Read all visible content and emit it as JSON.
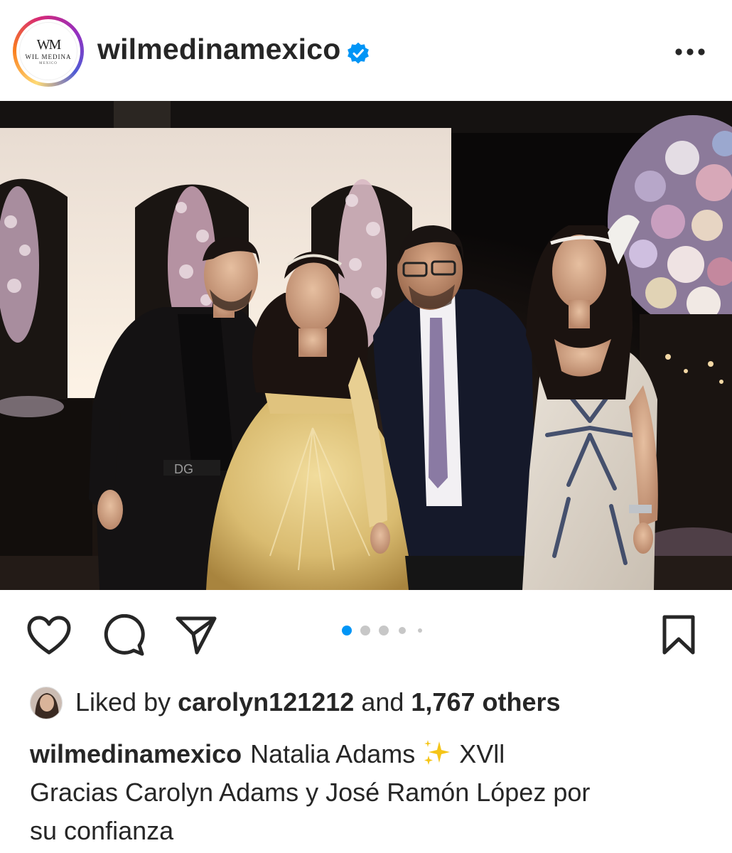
{
  "header": {
    "username": "wilmedinamexico",
    "verified": true,
    "avatar_logo": {
      "mark": "WM",
      "name": "WIL MEDINA",
      "sub": "MEXICO"
    },
    "more_icon": "more-horizontal-icon"
  },
  "photo": {
    "alt": ""
  },
  "actions": {
    "like_icon": "heart-icon",
    "comment_icon": "comment-icon",
    "share_icon": "share-icon",
    "save_icon": "bookmark-icon",
    "carousel": {
      "count": 5,
      "active_index": 0,
      "active_color": "#0095f6",
      "inactive_color": "#c7c7c7"
    }
  },
  "likes": {
    "prefix": "Liked by",
    "user": "carolyn121212",
    "joiner": "and",
    "others": "1,767 others"
  },
  "caption": {
    "username": "wilmedinamexico",
    "text_line1": "Natalia Adams",
    "emoji": "sparkles-icon",
    "text_line1_suffix": "XVll",
    "text_line2": "Gracias Carolyn Adams y José Ramón López por",
    "text_line3": "su confianza"
  }
}
